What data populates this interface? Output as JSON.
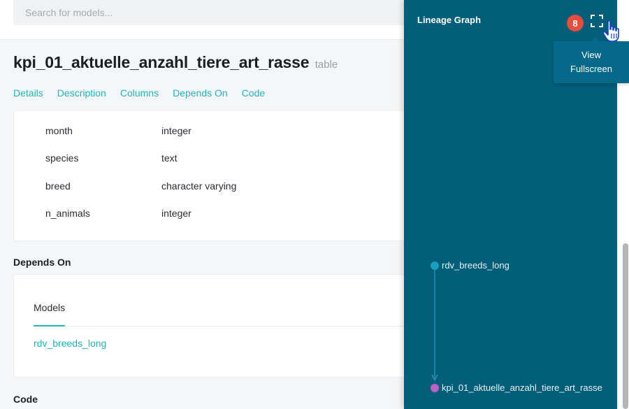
{
  "search": {
    "placeholder": "Search for models..."
  },
  "model": {
    "name": "kpi_01_aktuelle_anzahl_tiere_art_rasse",
    "type": "table"
  },
  "tabs": [
    {
      "label": "Details"
    },
    {
      "label": "Description"
    },
    {
      "label": "Columns"
    },
    {
      "label": "Depends On"
    },
    {
      "label": "Code"
    }
  ],
  "columns": [
    {
      "name": "month",
      "type": "integer"
    },
    {
      "name": "species",
      "type": "text"
    },
    {
      "name": "breed",
      "type": "character varying"
    },
    {
      "name": "n_animals",
      "type": "integer"
    }
  ],
  "depends_on": {
    "heading": "Depends On",
    "tab_label": "Models",
    "models": [
      "rdv_breeds_long"
    ]
  },
  "code_heading": "Code",
  "lineage": {
    "title": "Lineage Graph",
    "badge": "8",
    "fullscreen_icon": "expand-icon",
    "tooltip": {
      "line1": "View",
      "line2": "Fullscreen"
    },
    "nodes": [
      {
        "label": "rdv_breeds_long",
        "color": "#1a9fc4"
      },
      {
        "label": "kpi_01_aktuelle_anzahl_tiere_art_rasse",
        "color": "#c061c6"
      }
    ],
    "edge_color": "#2b8fb4",
    "background": "#025e79"
  },
  "colors": {
    "accent": "#1fb5bd",
    "badge": "#e84c3d"
  }
}
